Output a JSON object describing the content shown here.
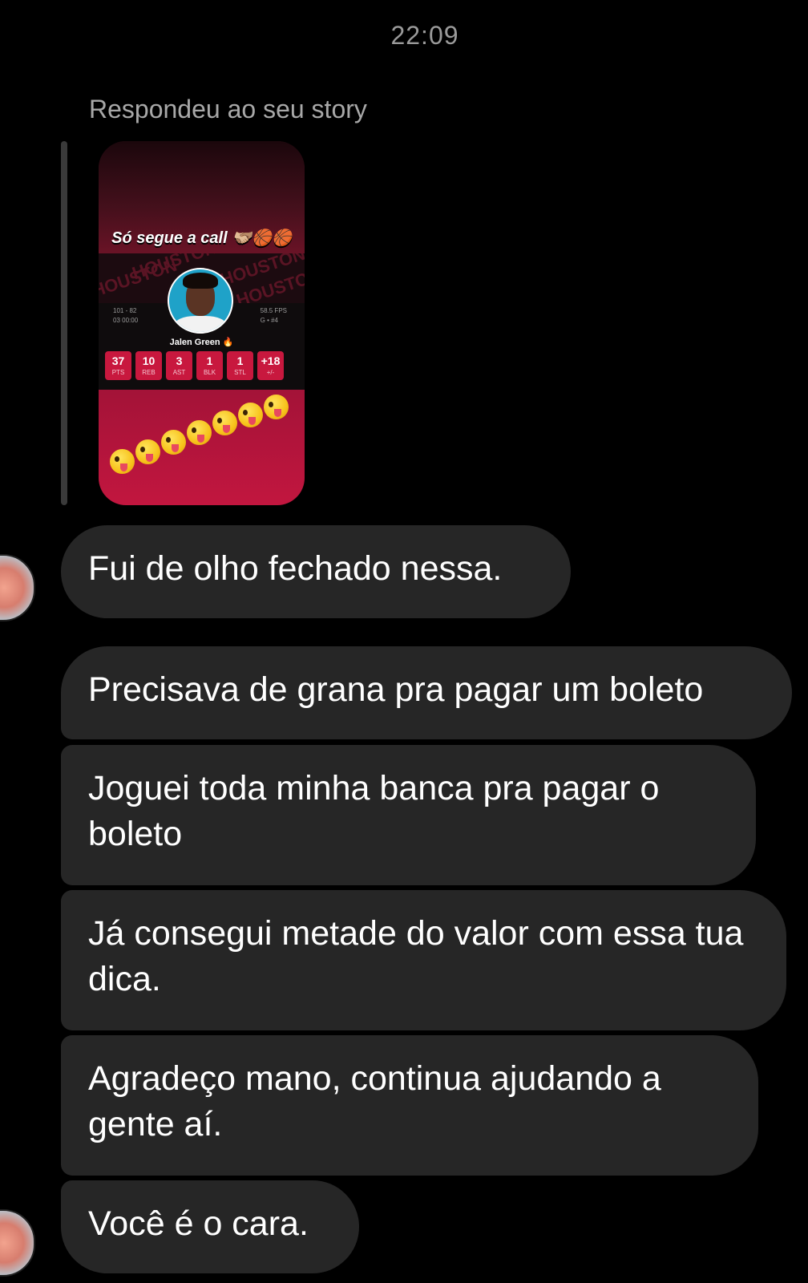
{
  "header": {
    "time": "22:09"
  },
  "reply": {
    "label": "Respondeu ao seu story"
  },
  "story": {
    "caption": "Só segue a call 🫱🏼‍🫲🏽🏀🏀",
    "card": {
      "player_name": "Jalen Green 🔥",
      "score_left_line1": "101 - 82",
      "score_left_line2": "03 00:00",
      "score_right_line1": "58.5 FPS",
      "score_right_line2": "G • #4",
      "stats": [
        {
          "value": "37",
          "label": "PTS"
        },
        {
          "value": "10",
          "label": "REB"
        },
        {
          "value": "3",
          "label": "AST"
        },
        {
          "value": "1",
          "label": "BLK"
        },
        {
          "value": "1",
          "label": "STL"
        },
        {
          "value": "+18",
          "label": "+/-"
        }
      ],
      "pattern_words": [
        "HOUSTON",
        "HOUSTON",
        "HOUSTON",
        "HOUSTON"
      ]
    },
    "emoji_name": "zany-face-icon",
    "emoji_count": 7
  },
  "messages": [
    {
      "text": "Fui de olho fechado nessa."
    },
    {
      "text": "Precisava de grana pra pagar um boleto"
    },
    {
      "text": "Joguei toda minha banca pra pagar o boleto"
    },
    {
      "text": "Já consegui metade do valor com essa tua dica."
    },
    {
      "text": "Agradeço mano, continua ajudando a gente aí."
    },
    {
      "text": "Você é o cara."
    }
  ],
  "colors": {
    "background": "#000000",
    "bubble": "#262626",
    "muted_text": "#a8a8a8",
    "stat_red": "#c8183e"
  }
}
